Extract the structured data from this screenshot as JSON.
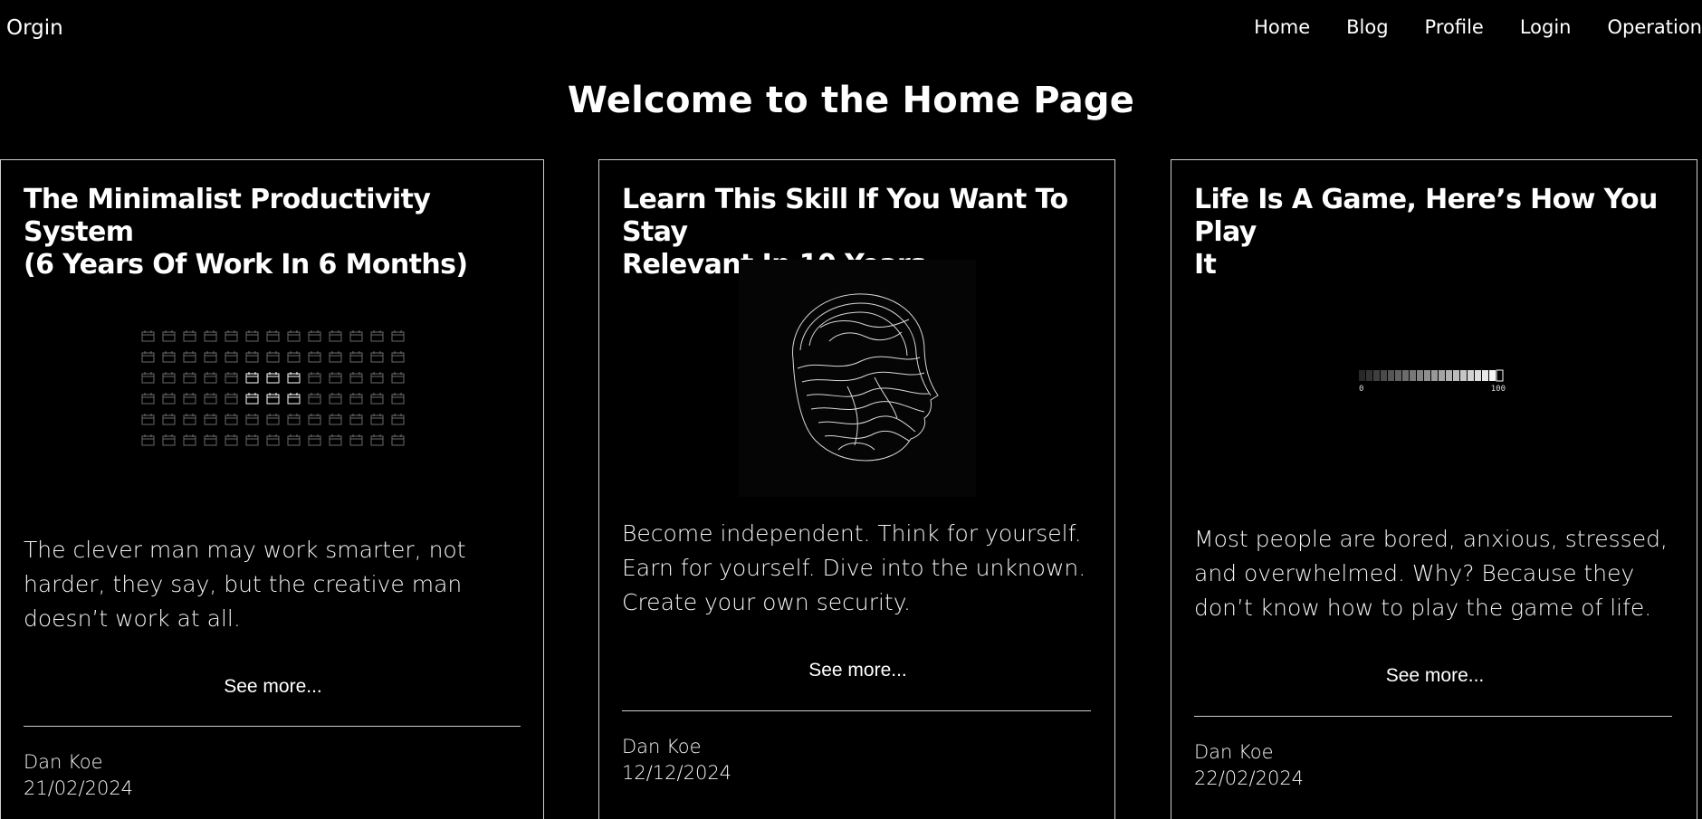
{
  "nav": {
    "brand": "Orgin",
    "links": [
      "Home",
      "Blog",
      "Profile",
      "Login",
      "Operation"
    ]
  },
  "page": {
    "heading": "Welcome to the Home Page"
  },
  "cards": [
    {
      "title_line1": "The Minimalist Productivity System",
      "title_line2": "(6 Years Of Work In 6 Months)",
      "desc_line1": "The clever man may work smarter, not",
      "desc_line2": "harder, they say, but the creative man",
      "desc_line3": "doesn’t work at all.",
      "see_more": "See more...",
      "author": "Dan Koe",
      "date": "21/02/2024",
      "image_icon": "calendar-grid-icon"
    },
    {
      "title_line1": "Learn This Skill If You Want To Stay",
      "title_line2": "Relevant In 10 Years",
      "desc_line1": "Become independent. Think for yourself.",
      "desc_line2": "Earn for yourself. Dive into the unknown.",
      "desc_line3": "Create your own security.",
      "see_more": "See more...",
      "author": "Dan Koe",
      "date": "12/12/2024",
      "image_icon": "head-contour-icon"
    },
    {
      "title_line1": "Life Is A Game, Here’s How You Play",
      "title_line2": "It",
      "desc_line1": "Most people are bored, anxious, stressed,",
      "desc_line2": "and overwhelmed. Why? Because they",
      "desc_line3": "don’t know how to play the game of life.",
      "see_more": "See more...",
      "author": "Dan Koe",
      "date": "22/02/2024",
      "image_icon": "progress-bar-icon",
      "progress": {
        "min_label": "0",
        "max_label": "100",
        "level_percent": 95
      }
    }
  ]
}
